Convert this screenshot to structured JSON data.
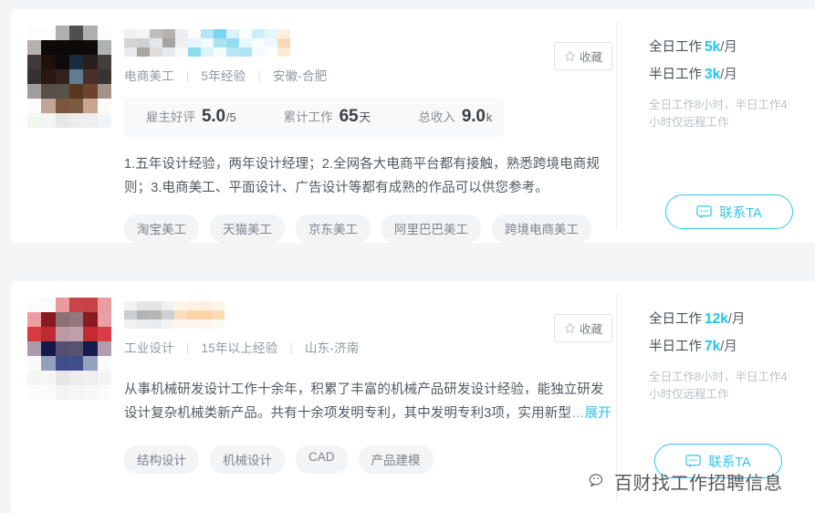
{
  "theme": {
    "accent": "#22c4ec",
    "page_bg": "#f4f5f6",
    "card_bg": "#ffffff",
    "tag_bg": "#f2f4f6",
    "muted": "#93999f"
  },
  "cards": [
    {
      "name_redacted": true,
      "meta": {
        "category": "电商美工",
        "experience": "5年经验",
        "location": "安徽-合肥"
      },
      "favorite": {
        "label": "收藏",
        "icon": "star-icon"
      },
      "stats": [
        {
          "label": "雇主好评",
          "value": "5.0",
          "unit": "/5"
        },
        {
          "label": "累计工作",
          "value": "65",
          "unit": "天"
        },
        {
          "label": "总收入",
          "value": "9.0",
          "unit": "k"
        }
      ],
      "description": "1.五年设计经验，两年设计经理；2.全网各大电商平台都有接触，熟悉跨境电商规则；3.电商美工、平面设计、广告设计等都有成熟的作品可以供您参考。",
      "expand_label": "",
      "ellipsis": "",
      "tags": [
        "淘宝美工",
        "天猫美工",
        "京东美工",
        "阿里巴巴美工",
        "跨境电商美工"
      ],
      "pay": [
        {
          "label": "全日工作",
          "amount": "5k",
          "per": "/月"
        },
        {
          "label": "半日工作",
          "amount": "3k",
          "per": "/月"
        }
      ],
      "note": "全日工作8小时，半日工作4小时仅远程工作",
      "contact": {
        "label": "联系TA",
        "icon": "chat-bubble-icon"
      }
    },
    {
      "name_redacted": true,
      "meta": {
        "category": "工业设计",
        "experience": "15年以上经验",
        "location": "山东-济南"
      },
      "favorite": {
        "label": "收藏",
        "icon": "star-icon"
      },
      "stats": [],
      "description": "从事机械研发设计工作十余年，积累了丰富的机械产品研发设计经验，能独立研发设计复杂机械类新产品。共有十余项发明专利，其中发明专利3项，实用新型",
      "ellipsis": "…",
      "expand_label": "展开",
      "tags": [
        "结构设计",
        "机械设计",
        "CAD",
        "产品建模"
      ],
      "pay": [
        {
          "label": "全日工作",
          "amount": "12k",
          "per": "/月"
        },
        {
          "label": "半日工作",
          "amount": "7k",
          "per": "/月"
        }
      ],
      "note": "全日工作8小时，半日工作4小时仅远程工作",
      "contact": {
        "label": "联系TA",
        "icon": "chat-bubble-icon"
      }
    }
  ],
  "watermark": {
    "text": "百财找工作招聘信息",
    "icon": "wechat-logo-icon"
  },
  "mosaics": {
    "avatar1": [
      "#fdfdfd",
      "#fdfdfd",
      "#b0b0b0",
      "#4f4f4f",
      "#afafaf",
      "#fcfcfc",
      "#b4b0ad",
      "#0d0b0a",
      "#0b0a09",
      "#0c0a09",
      "#0e0c0a",
      "#aeb2b0",
      "#41383a",
      "#1e100c",
      "#0d0c0b",
      "#1b2c3c",
      "#2b1f1c",
      "#443e39",
      "#363130",
      "#281a12",
      "#33221c",
      "#607b92",
      "#49302a",
      "#373431",
      "#a09d9a",
      "#574f46",
      "#57514a",
      "#593620",
      "#6d432c",
      "#a3938a",
      "#fbfbfb",
      "#c2a494",
      "#7b563c",
      "#7b5a40",
      "#caa58d",
      "#fdfbfa",
      "#f1f8f0",
      "#f5f5f4",
      "#e6e8e6",
      "#ececec",
      "#eeeeef",
      "#f3f4f5"
    ],
    "avatar2": [
      "#fcfcfc",
      "#fbfbfb",
      "#e89a9c",
      "#c8434a",
      "#c94148",
      "#e99ba0",
      "#eb9ea0",
      "#8a1a22",
      "#8b7075",
      "#93777c",
      "#8b1a22",
      "#e9a0a3",
      "#d83c42",
      "#c02b33",
      "#bc9aa3",
      "#bfa0a8",
      "#c52a32",
      "#d93d43",
      "#ab9aab",
      "#151a4a",
      "#545070",
      "#56526f",
      "#171c4d",
      "#b09dad",
      "#fafafa",
      "#93a0bd",
      "#3f4e8a",
      "#404f8b",
      "#95a2be",
      "#fbfbfb",
      "#f2f8f1",
      "#f6f6f5",
      "#e7e7e7",
      "#ededed",
      "#efeff0",
      "#f4f4f5",
      "#fbfcfb",
      "#fafafa",
      "#f4f4f4",
      "#f6f6f6",
      "#f7f7f8",
      "#fafafb"
    ],
    "name1": [
      "#f0f1f2",
      "#d4d5d6",
      "#e9eaeb",
      "#f4f5f6",
      "#d0d1d2",
      "#a9a6a4",
      "#bdbdbe",
      "#e6e7e8",
      "#dcdcdd",
      "#b3b2b1",
      "#a4a3a2",
      "#e9eaeb",
      "#eceef0",
      "#edf0f2",
      "#f7f9fa",
      "#fbfcfc",
      "#e7f6fb",
      "#8ddcef",
      "#b3e6f4",
      "#f3fbfd",
      "#dff3fa",
      "#77d5ed",
      "#a9e3f3",
      "#f5fcfd",
      "#dcf2fa",
      "#92dcef",
      "#b8e7f4",
      "#f7fdfd",
      "#eaf8fc",
      "#aee4f3",
      "#cdeef7",
      "#fafdfe",
      "#f4fbfd",
      "#e5f6fb",
      "#eef9fc",
      "#fdfefe",
      "#fdf0e3",
      "#fbd9b4",
      "#fcead4",
      "#fefaf5",
      "#fdeedf",
      "#fcd5aa",
      "#fbe4c6",
      "#fefaf4",
      "#fdf1e6",
      "#fbd2a3",
      "#fbe2c2",
      "#fefaf4",
      "#fdf6ee",
      "#fdeedf",
      "#fdf5ec",
      "#fefdfb"
    ],
    "name2": [
      "#f4f2f1",
      "#cdcecf",
      "#f1f1f1",
      "#e6e5e5",
      "#b2b4b6",
      "#ececed",
      "#e4e5e6",
      "#b4b6b8",
      "#eaebec",
      "#f0f1f2",
      "#ced0d2",
      "#f3f4f5",
      "#fdf4ea",
      "#fbdcbc",
      "#fdf6ef",
      "#fdf1e4",
      "#fbd4a8",
      "#fdf6ee",
      "#fdf0e1",
      "#fbd3a6",
      "#fdf5ed",
      "#fdf4e9",
      "#fbd9b2",
      "#fdf8f2",
      "#fefaf5",
      "#fdeede",
      "#fefbf8"
    ]
  }
}
